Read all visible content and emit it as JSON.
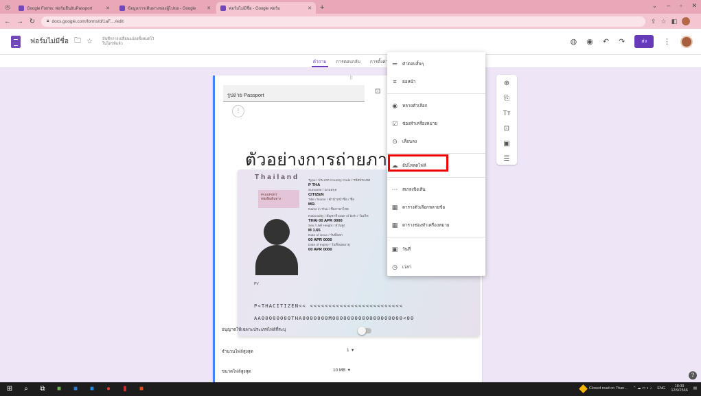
{
  "browser": {
    "tabs": [
      {
        "label": "Google Forms: ฟอร์มยืนยันPassport",
        "color": "#7248b9",
        "active": false
      },
      {
        "label": "ข้อมูลการเดินทางของผู้ไปขอ - Google",
        "color": "#7248b9",
        "active": false
      },
      {
        "label": "ฟอร์มไม่มีชื่อ - Google ฟอร์ม",
        "color": "#7248b9",
        "active": true
      }
    ],
    "new_tab": "+",
    "url": "docs.google.com/forms/d/1aF..../edit"
  },
  "forms_header": {
    "title": "ฟอร์มไม่มีชื่อ",
    "saved_note": "บันทึกการเปลี่ยนแปลงทั้งหมดไว้ในไดรฟ์แล้ว",
    "send_label": "ส่ง"
  },
  "form_tabs": [
    "คำถาม",
    "การตอบกลับ",
    "การตั้งค่า"
  ],
  "question": {
    "title": "รูปถ่าย Passport",
    "image_heading": "ตัวอย่างการถ่ายภาพ",
    "options": [
      {
        "label": "อนุญาตให้เฉพาะประเภทไฟล์ที่ระบุ"
      },
      {
        "label": "จำนวนไฟล์สูงสุด",
        "value": "1"
      },
      {
        "label": "ขนาดไฟล์สูงสุด",
        "value": "10 MB"
      }
    ]
  },
  "passport": {
    "country": "Thailand",
    "stamp": "PASSPORT หนังสือเดินทาง",
    "fields": [
      {
        "label": "Type / ประเภท   Country Code / รหัสประเทศ",
        "value": "P        THA"
      },
      {
        "label": "Surname / นามสกุล",
        "value": "CITIZEN"
      },
      {
        "label": "Title / Name / คำนำหน้าชื่อ / ชื่อ",
        "value": "MR."
      },
      {
        "label": "Name in Thai / ชื่อภาษาไทย",
        "value": ""
      },
      {
        "label": "Nationality / สัญชาติ   Date of birth / วันเกิด",
        "value": "THAI        00 APR 0000"
      },
      {
        "label": "Sex / เพศ   Height / ส่วนสูง",
        "value": "M           1.65"
      },
      {
        "label": "Date of issue / วันที่ออก",
        "value": "00 APR 0000"
      },
      {
        "label": "Date of expiry / วันที่หมดอายุ",
        "value": "00 APR 0000"
      }
    ],
    "pv": "PV",
    "mrz_line1": "P<THACITIZEN<<   <<<<<<<<<<<<<<<<<<<<<<<<<",
    "mrz_line2": "AA00000000THA0000000M0000000000000000000<00"
  },
  "menu": {
    "items": [
      {
        "icon": "short-answer-icon",
        "glyph": "═",
        "label": "คำตอบสั้นๆ"
      },
      {
        "icon": "paragraph-icon",
        "glyph": "≡",
        "label": "ย่อหน้า"
      },
      {
        "divider": true
      },
      {
        "icon": "radio-icon",
        "glyph": "◉",
        "label": "หลายตัวเลือก"
      },
      {
        "icon": "checkbox-icon",
        "glyph": "☑",
        "label": "ช่องทำเครื่องหมาย"
      },
      {
        "icon": "dropdown-icon",
        "glyph": "⊙",
        "label": "เลื่อนลง"
      },
      {
        "divider": true
      },
      {
        "icon": "upload-icon",
        "glyph": "☁",
        "label": "อัปโหลดไฟล์"
      },
      {
        "divider": true
      },
      {
        "icon": "linear-scale-icon",
        "glyph": "⋯",
        "label": "สเกลเชิงเส้น"
      },
      {
        "icon": "grid-icon",
        "glyph": "▦",
        "label": "ตารางตัวเลือกหลายข้อ"
      },
      {
        "icon": "checkbox-grid-icon",
        "glyph": "▦",
        "label": "ตารางช่องทำเครื่องหมาย"
      },
      {
        "divider": true
      },
      {
        "icon": "date-icon",
        "glyph": "▣",
        "label": "วันที่"
      },
      {
        "icon": "time-icon",
        "glyph": "◷",
        "label": "เวลา"
      }
    ]
  },
  "taskbar": {
    "weather": "Closed road on Than...",
    "lang": "ENG",
    "time": "18:39",
    "date": "12/9/2566"
  }
}
